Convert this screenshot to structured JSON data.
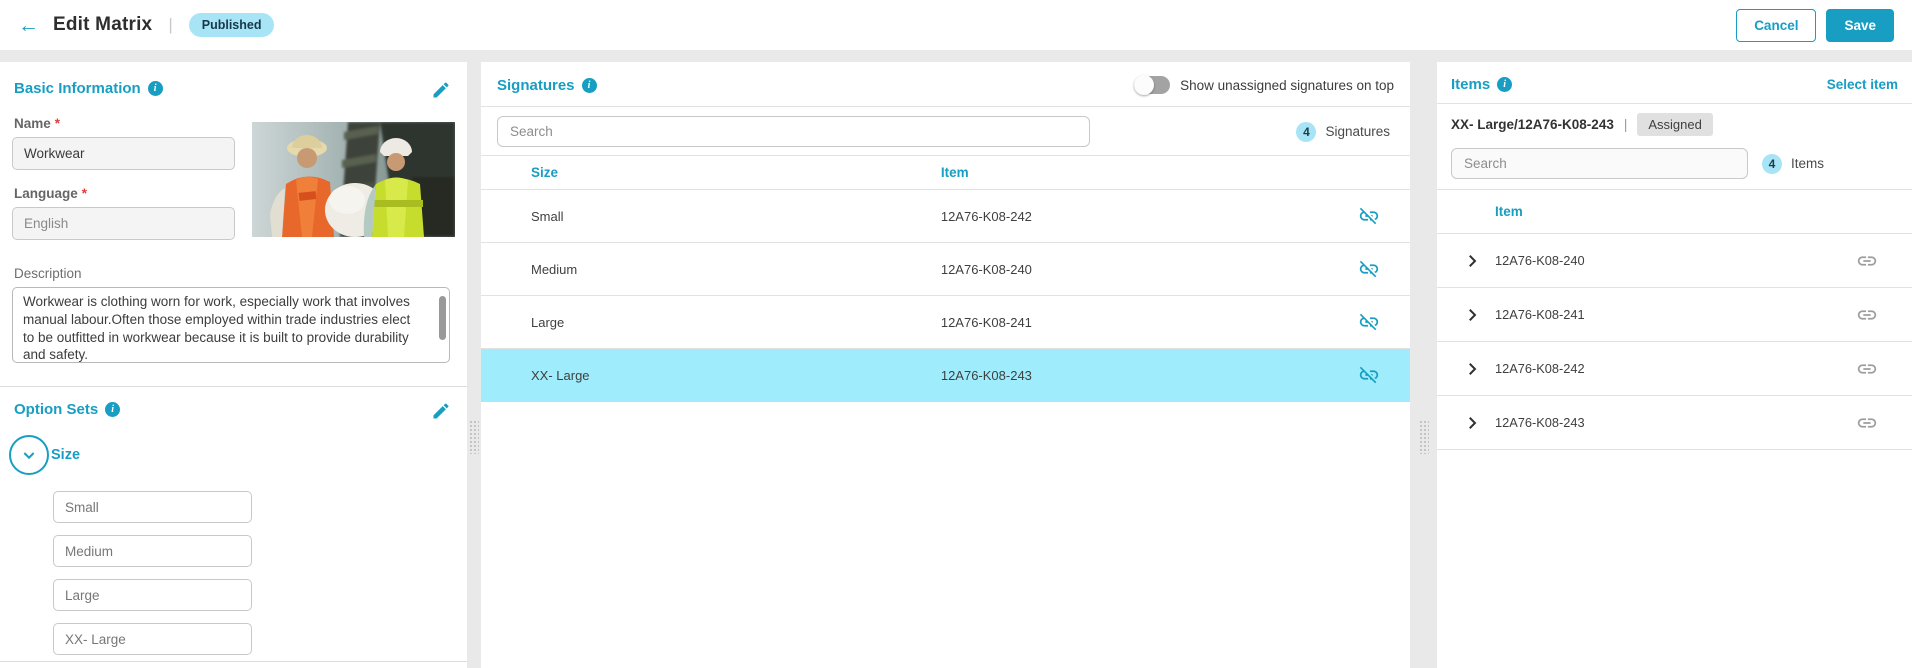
{
  "header": {
    "title": "Edit Matrix",
    "separator": "|",
    "status_badge": "Published",
    "cancel_label": "Cancel",
    "save_label": "Save"
  },
  "basic_info": {
    "title": "Basic Information",
    "name_label": "Name",
    "name_value": "Workwear",
    "language_label": "Language",
    "language_value": "English",
    "description_label": "Description",
    "description_value": "Workwear is clothing worn for work, especially work that involves manual labour.Often those employed within trade industries elect to be outfitted in workwear because it is built to provide durability and safety.",
    "image_name": "workers-photo"
  },
  "option_sets": {
    "title": "Option Sets",
    "group_name": "Size",
    "values": [
      "Small",
      "Medium",
      "Large",
      "XX- Large"
    ]
  },
  "signatures": {
    "title": "Signatures",
    "toggle_label": "Show unassigned signatures on top",
    "search_placeholder": "Search",
    "count": "4",
    "count_label": "Signatures",
    "columns": {
      "size": "Size",
      "item": "Item"
    },
    "rows": [
      {
        "size": "Small",
        "item": "12A76-K08-242",
        "selected": false
      },
      {
        "size": "Medium",
        "item": "12A76-K08-240",
        "selected": false
      },
      {
        "size": "Large",
        "item": "12A76-K08-241",
        "selected": false
      },
      {
        "size": "XX- Large",
        "item": "12A76-K08-243",
        "selected": true
      }
    ]
  },
  "items": {
    "title": "Items",
    "select_item_label": "Select item",
    "selection_text": "XX- Large/12A76-K08-243",
    "selection_separator": "|",
    "selection_badge": "Assigned",
    "search_placeholder": "Search",
    "count": "4",
    "count_label": "Items",
    "column_header": "Item",
    "rows": [
      {
        "code": "12A76-K08-240"
      },
      {
        "code": "12A76-K08-241"
      },
      {
        "code": "12A76-K08-242"
      },
      {
        "code": "12A76-K08-243"
      }
    ]
  },
  "colors": {
    "accent": "#189ec2",
    "published_badge_bg": "#a7e5f6",
    "selected_row_bg": "#9fecfd",
    "assigned_badge_bg": "#e0e0e0"
  }
}
